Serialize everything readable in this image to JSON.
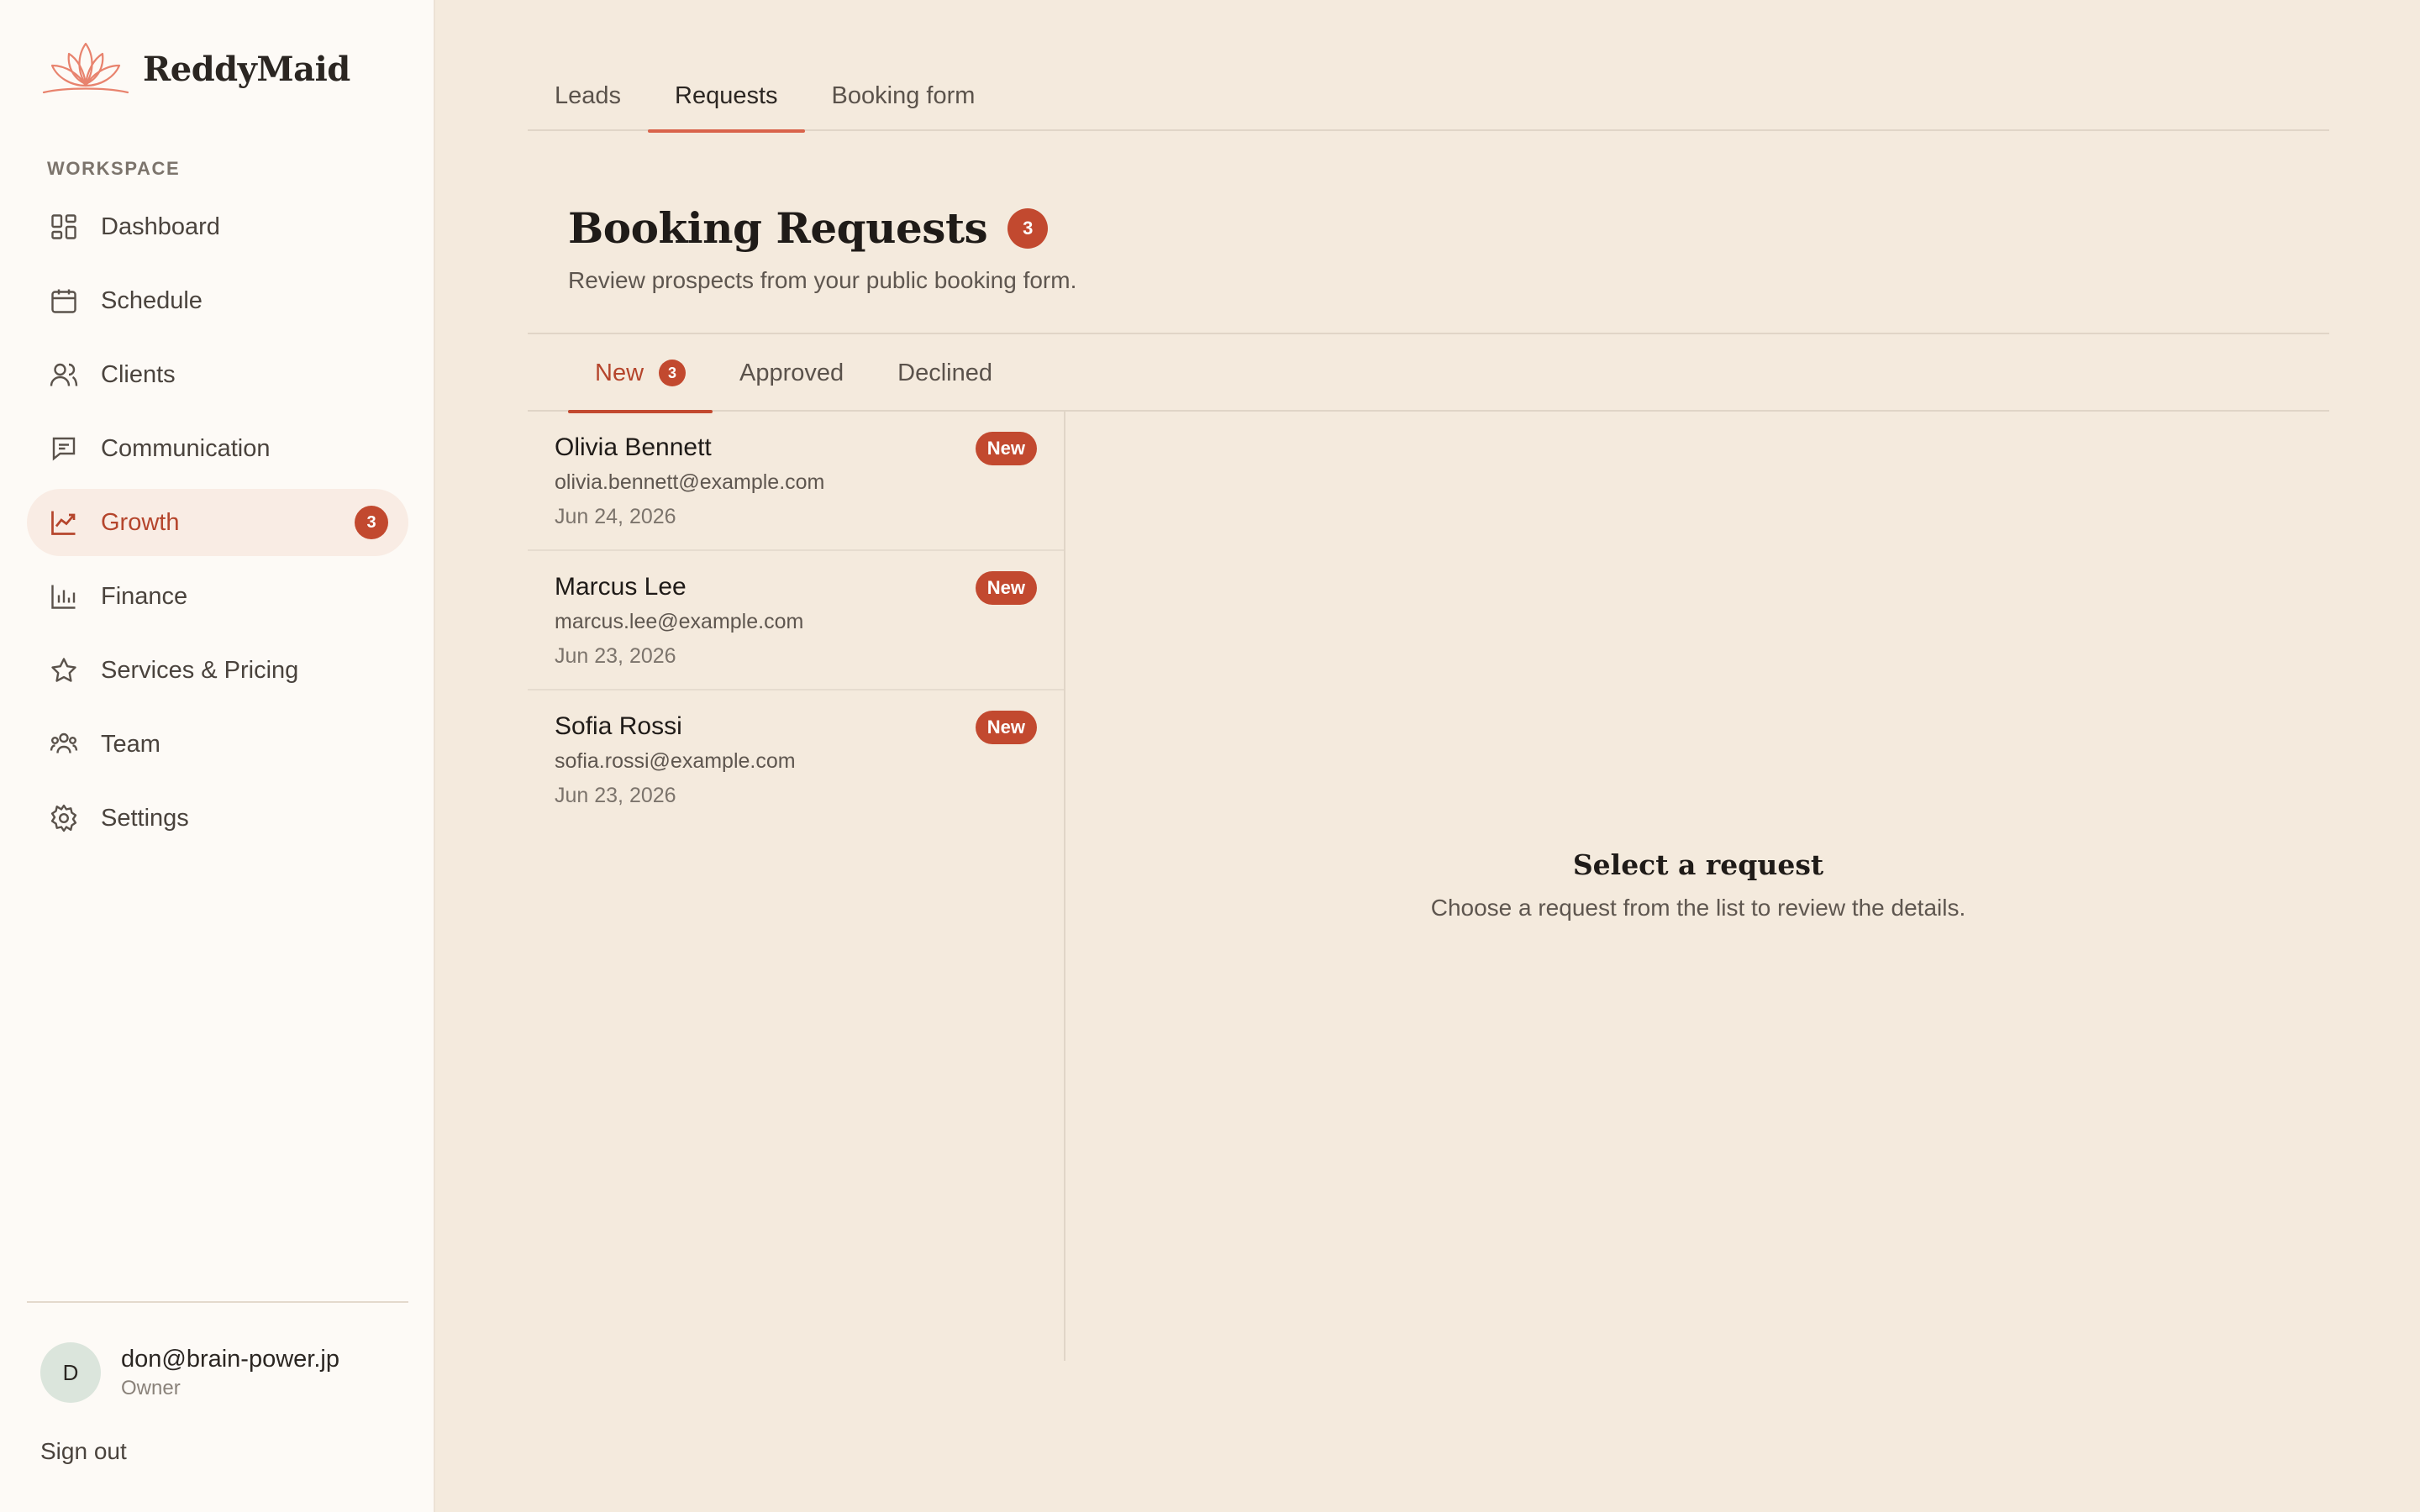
{
  "brand": {
    "name": "ReddyMaid"
  },
  "sidebar": {
    "section_label": "WORKSPACE",
    "items": [
      {
        "label": "Dashboard",
        "icon": "dashboard-icon"
      },
      {
        "label": "Schedule",
        "icon": "calendar-icon"
      },
      {
        "label": "Clients",
        "icon": "users-icon"
      },
      {
        "label": "Communication",
        "icon": "message-icon"
      },
      {
        "label": "Growth",
        "icon": "trend-icon",
        "badge": "3",
        "active": true
      },
      {
        "label": "Finance",
        "icon": "bar-chart-icon"
      },
      {
        "label": "Services & Pricing",
        "icon": "star-icon"
      },
      {
        "label": "Team",
        "icon": "team-icon"
      },
      {
        "label": "Settings",
        "icon": "gear-icon"
      }
    ],
    "user": {
      "initial": "D",
      "email": "don@brain-power.jp",
      "role": "Owner"
    },
    "signout_label": "Sign out"
  },
  "top_tabs": [
    {
      "label": "Leads"
    },
    {
      "label": "Requests",
      "active": true
    },
    {
      "label": "Booking form"
    }
  ],
  "page": {
    "title": "Booking Requests",
    "count": "3",
    "subtitle": "Review prospects from your public booking form."
  },
  "sub_tabs": [
    {
      "label": "New",
      "badge": "3",
      "active": true
    },
    {
      "label": "Approved"
    },
    {
      "label": "Declined"
    }
  ],
  "requests": [
    {
      "name": "Olivia Bennett",
      "email": "olivia.bennett@example.com",
      "date": "Jun 24, 2026",
      "status": "New"
    },
    {
      "name": "Marcus Lee",
      "email": "marcus.lee@example.com",
      "date": "Jun 23, 2026",
      "status": "New"
    },
    {
      "name": "Sofia Rossi",
      "email": "sofia.rossi@example.com",
      "date": "Jun 23, 2026",
      "status": "New"
    }
  ],
  "empty_state": {
    "title": "Select a request",
    "subtitle": "Choose a request from the list to review the details."
  },
  "colors": {
    "accent": "#c2492f",
    "accent_light": "#d9634a",
    "background": "#f4eadd",
    "sidebar_bg": "#fdfaf6"
  }
}
